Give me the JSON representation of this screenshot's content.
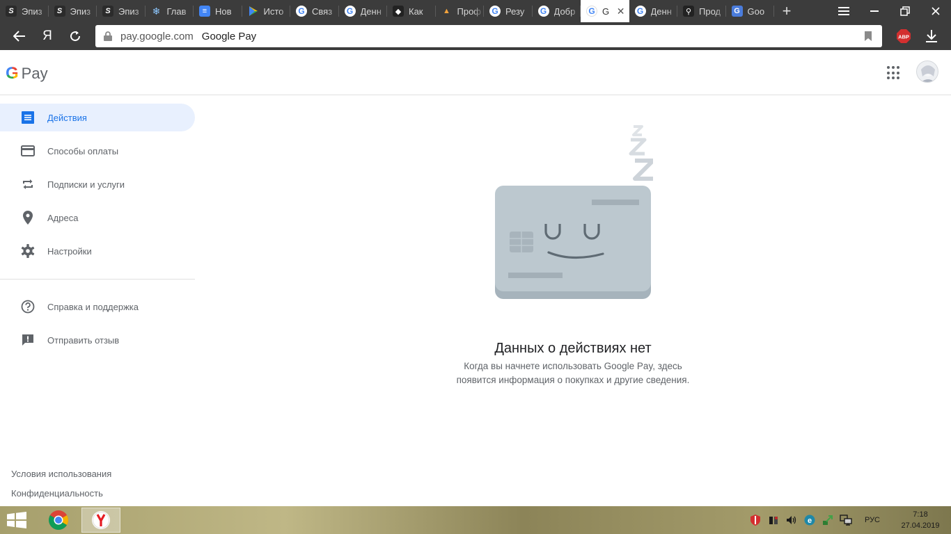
{
  "browser": {
    "tabs": [
      {
        "label": "Эпиз",
        "icon": "s-icon"
      },
      {
        "label": "Эпиз",
        "icon": "s-icon"
      },
      {
        "label": "Эпиз",
        "icon": "s-icon"
      },
      {
        "label": "Глав",
        "icon": "snowflake-icon"
      },
      {
        "label": "Нов",
        "icon": "docs-icon"
      },
      {
        "label": "Исто",
        "icon": "play-store-icon"
      },
      {
        "label": "Связ",
        "icon": "google-icon"
      },
      {
        "label": "Денн",
        "icon": "google-icon"
      },
      {
        "label": "Как",
        "icon": "shield-icon"
      },
      {
        "label": "Проф",
        "icon": "hat-icon"
      },
      {
        "label": "Резу",
        "icon": "google-icon"
      },
      {
        "label": "Добр",
        "icon": "google-icon"
      },
      {
        "label": "G",
        "icon": "google-icon",
        "active": true
      },
      {
        "label": "Денн",
        "icon": "google-icon"
      },
      {
        "label": "Прод",
        "icon": "search-icon"
      },
      {
        "label": "Goo",
        "icon": "translate-icon"
      }
    ],
    "yandex_letter": "Я",
    "address": {
      "domain": "pay.google.com",
      "title": "Google Pay"
    },
    "abp_label": "ABP"
  },
  "app": {
    "logo_g": "G",
    "logo_text": "Pay"
  },
  "sidebar": {
    "items": [
      {
        "label": "Действия",
        "icon": "list-icon",
        "active": true
      },
      {
        "label": "Способы оплаты",
        "icon": "credit-card-icon"
      },
      {
        "label": "Подписки и услуги",
        "icon": "repeat-icon"
      },
      {
        "label": "Адреса",
        "icon": "location-pin-icon"
      },
      {
        "label": "Настройки",
        "icon": "gear-icon"
      }
    ],
    "secondary": [
      {
        "label": "Справка и поддержка",
        "icon": "help-icon"
      },
      {
        "label": "Отправить отзыв",
        "icon": "feedback-icon"
      }
    ],
    "footer": {
      "terms": "Условия использования",
      "privacy": "Конфиденциальность"
    }
  },
  "empty_state": {
    "title": "Данных о действиях нет",
    "description": "Когда вы начнете использовать Google Pay, здесь появится информация о покупках и другие сведения."
  },
  "taskbar": {
    "lang": "РУС",
    "time": "7:18",
    "date": "27.04.2019"
  },
  "colors": {
    "accent": "#1a73e8",
    "active_bg": "#e8f0fe",
    "chrome_dark": "#3c3c3c"
  }
}
